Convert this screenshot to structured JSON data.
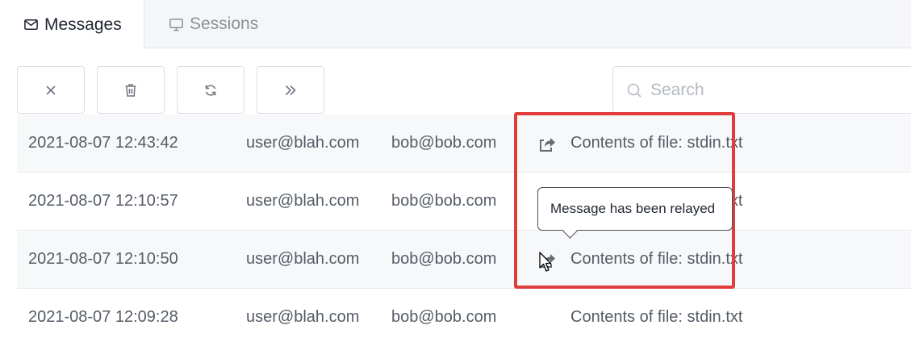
{
  "tabs": [
    {
      "label": "Messages",
      "icon": "mail-icon",
      "active": true
    },
    {
      "label": "Sessions",
      "icon": "monitor-icon",
      "active": false
    }
  ],
  "toolbar": {
    "buttons": [
      {
        "icon": "close-icon"
      },
      {
        "icon": "trash-icon"
      },
      {
        "icon": "refresh-icon"
      },
      {
        "icon": "double-chevron-right-icon"
      }
    ]
  },
  "search": {
    "placeholder": "Search",
    "value": "",
    "icon": "search-icon"
  },
  "messages": [
    {
      "date": "2021-08-07 12:43:42",
      "from": "user@blah.com",
      "to": "bob@bob.com",
      "relayed": true,
      "subject": "Contents of file: stdin.txt"
    },
    {
      "date": "2021-08-07 12:10:57",
      "from": "user@blah.com",
      "to": "bob@bob.com",
      "relayed": true,
      "subject": "Contents of file: stdin.txt"
    },
    {
      "date": "2021-08-07 12:10:50",
      "from": "user@blah.com",
      "to": "bob@bob.com",
      "relayed": true,
      "subject": "Contents of file: stdin.txt"
    },
    {
      "date": "2021-08-07 12:09:28",
      "from": "user@blah.com",
      "to": "bob@bob.com",
      "relayed": false,
      "subject": "Contents of file: stdin.txt"
    }
  ],
  "tooltip": {
    "text": "Message has been relayed"
  },
  "colors": {
    "highlight": "#e03c3c",
    "active_tab_text": "#1f2530",
    "muted_text": "#8a9099"
  }
}
